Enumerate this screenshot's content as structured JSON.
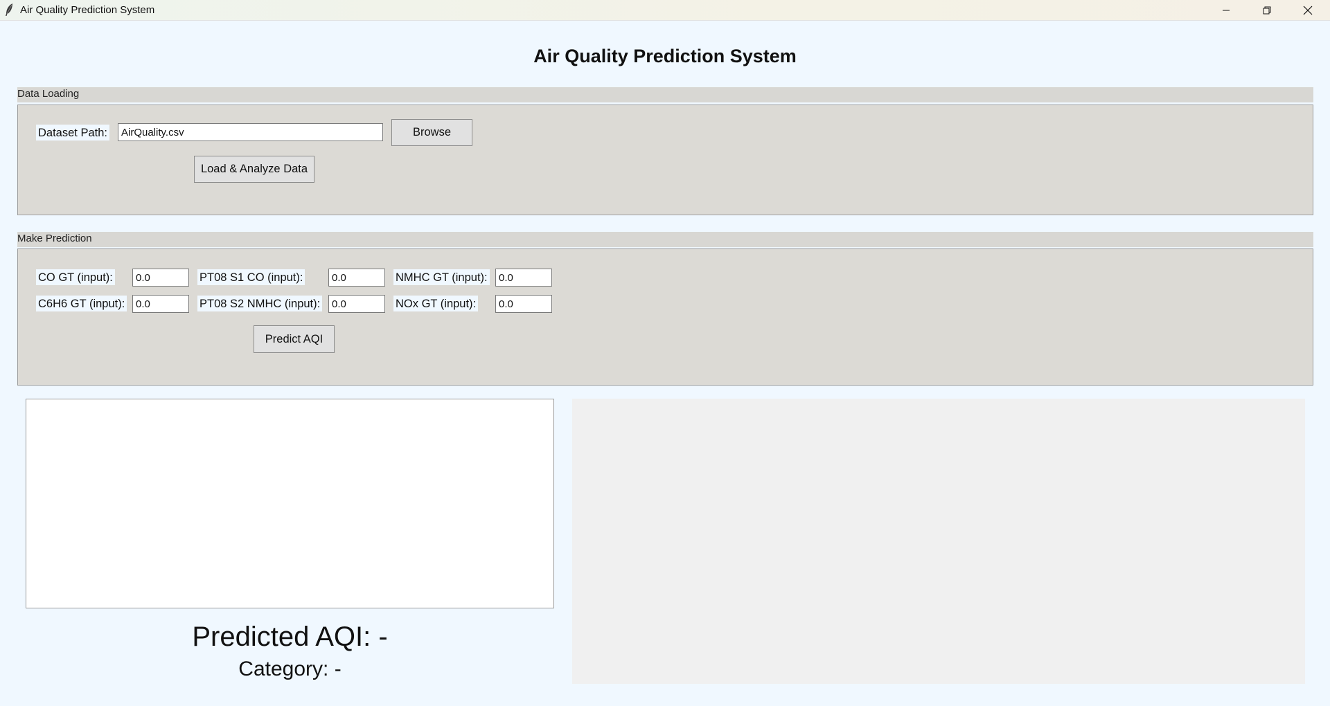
{
  "window": {
    "title": "Air Quality Prediction System",
    "controls": [
      "minimize-icon",
      "restore-icon",
      "close-icon"
    ]
  },
  "header": {
    "title": "Air Quality Prediction System"
  },
  "data_loading": {
    "title": "Data Loading",
    "dataset_label": "Dataset Path:",
    "dataset_value": "AirQuality.csv",
    "browse_label": "Browse",
    "load_label": "Load & Analyze Data"
  },
  "prediction": {
    "title": "Make Prediction",
    "fields": [
      {
        "label": "CO GT (input):",
        "value": "0.0"
      },
      {
        "label": "PT08 S1 CO (input):",
        "value": "0.0"
      },
      {
        "label": "NMHC GT (input):",
        "value": "0.0"
      },
      {
        "label": "C6H6 GT (input):",
        "value": "0.0"
      },
      {
        "label": "PT08 S2 NMHC (input):",
        "value": "0.0"
      },
      {
        "label": "NOx GT (input):",
        "value": "0.0"
      }
    ],
    "predict_label": "Predict AQI"
  },
  "results": {
    "aqi_text": "Predicted AQI: -",
    "category_text": "Category: -"
  },
  "colors": {
    "background": "#f0f8ff",
    "panel": "#dcdad5",
    "button": "#e1e1e1"
  }
}
